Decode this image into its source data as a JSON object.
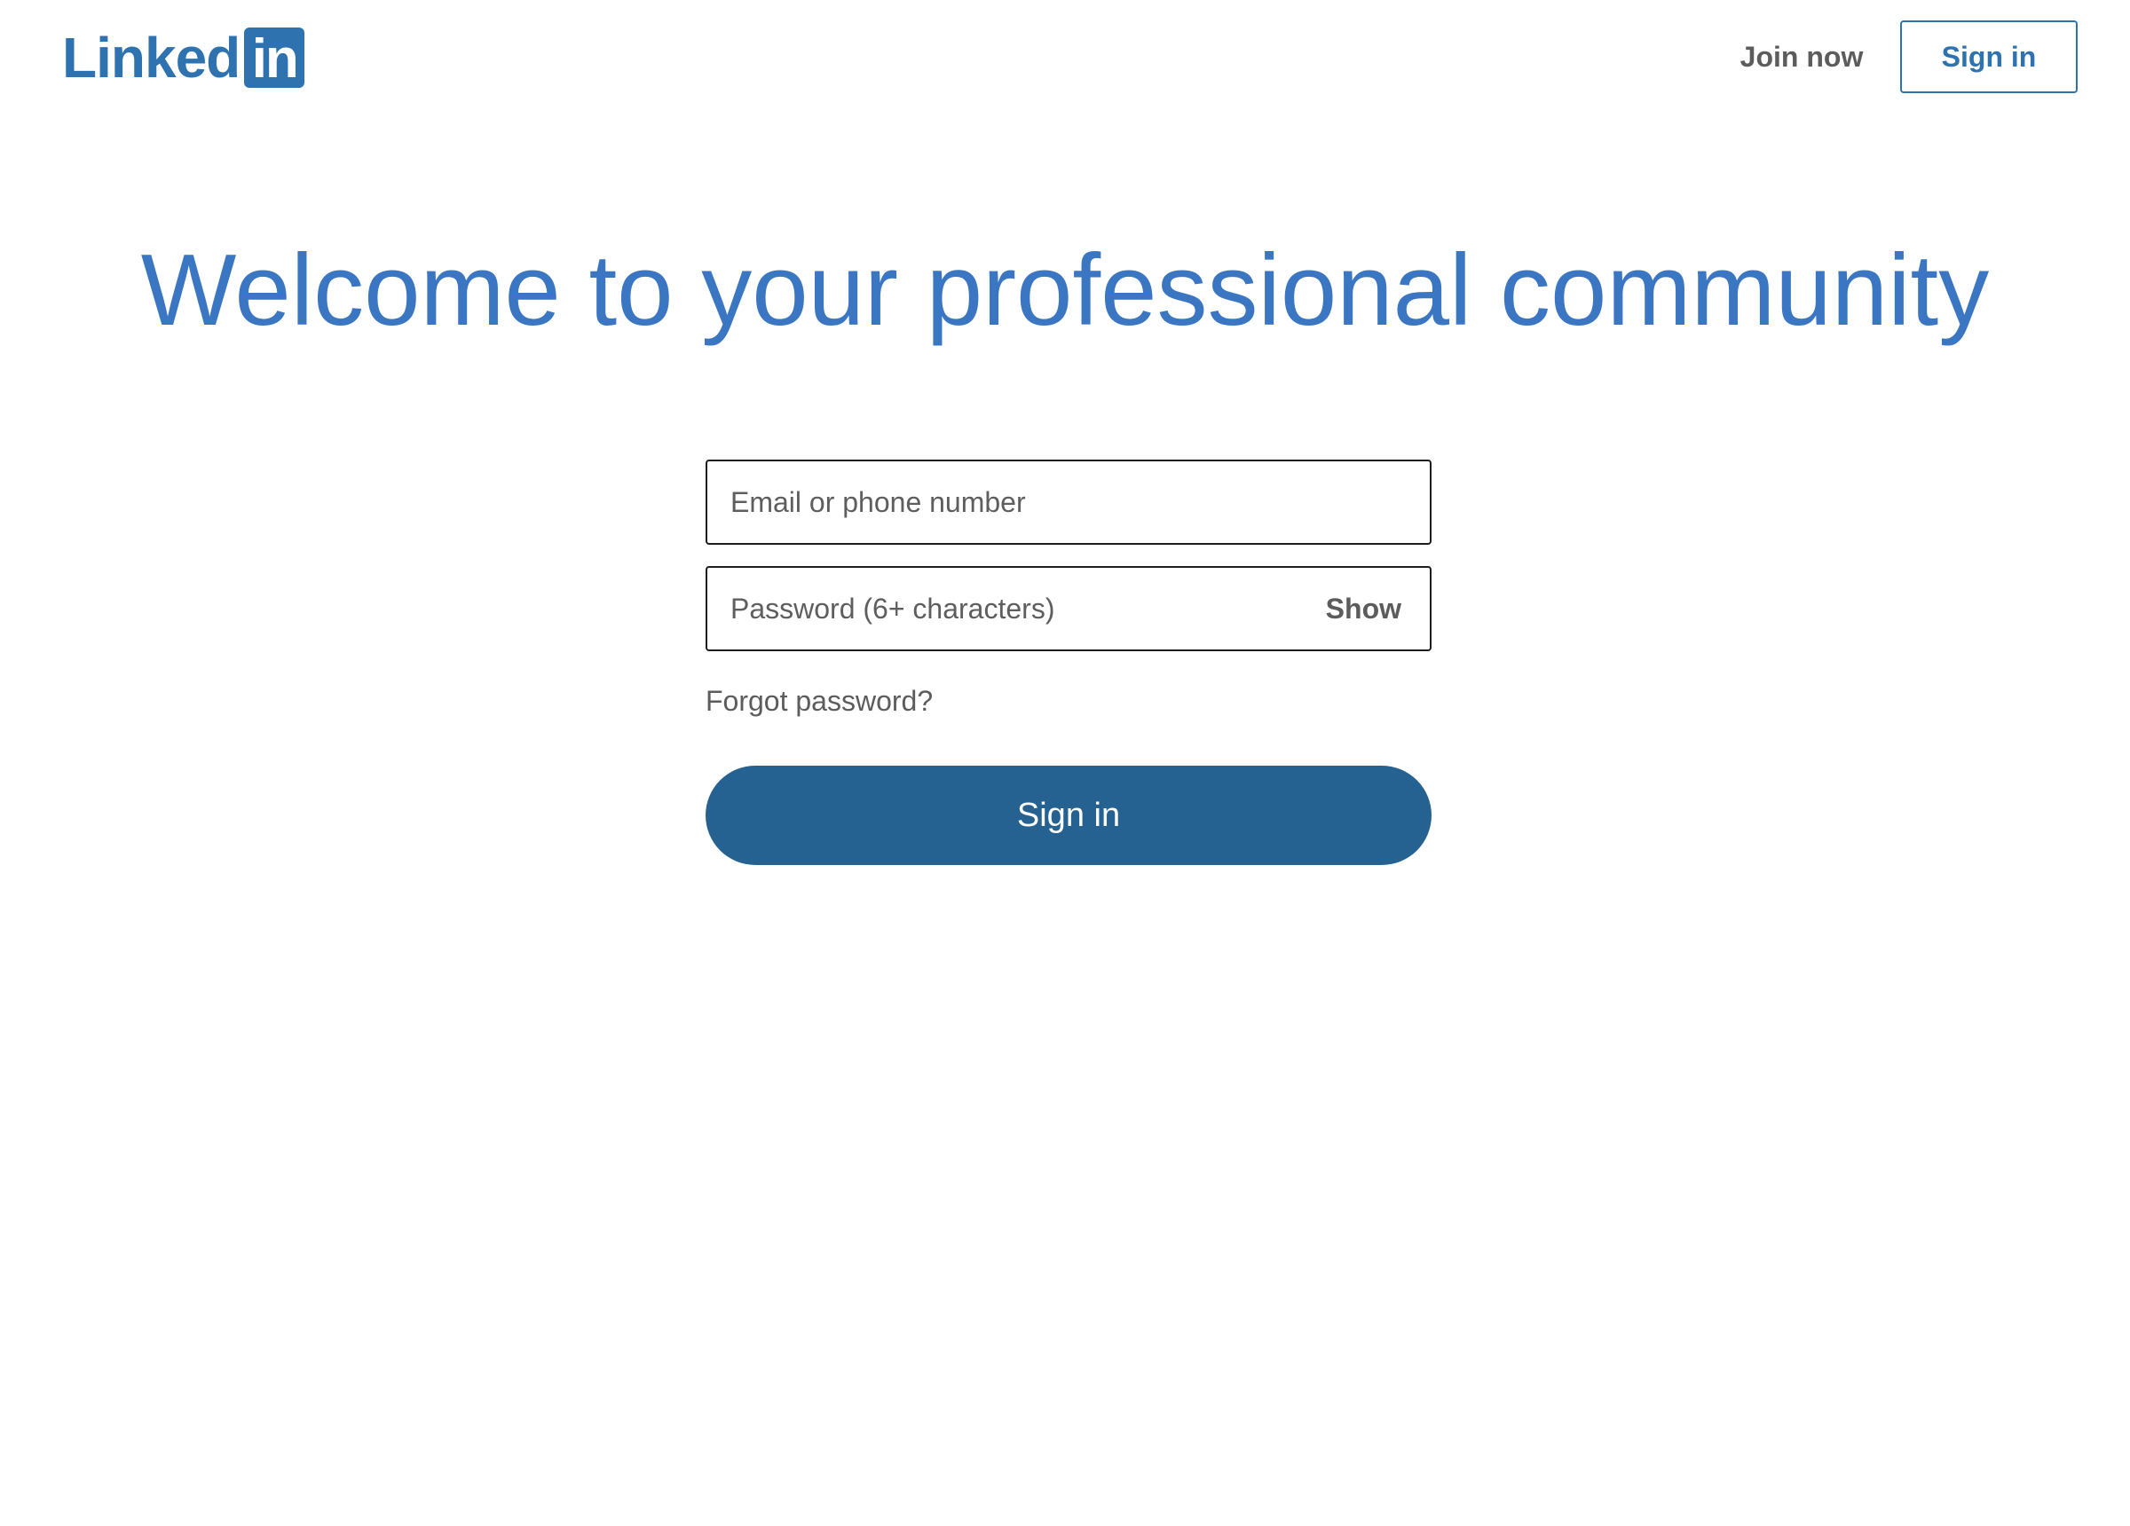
{
  "header": {
    "logo_word": "Linked",
    "logo_box": "in",
    "join_now_label": "Join now",
    "sign_in_label": "Sign in"
  },
  "main": {
    "headline": "Welcome to your professional community",
    "email_placeholder": "Email or phone number",
    "email_value": "",
    "password_placeholder": "Password (6+ characters)",
    "password_value": "",
    "show_label": "Show",
    "forgot_label": "Forgot password?",
    "sign_in_button_label": "Sign in"
  },
  "colors": {
    "brand_blue": "#2e72b0",
    "headline_blue": "#3b76c3",
    "primary_button": "#266291",
    "secondary_text": "#5c5c5c"
  }
}
